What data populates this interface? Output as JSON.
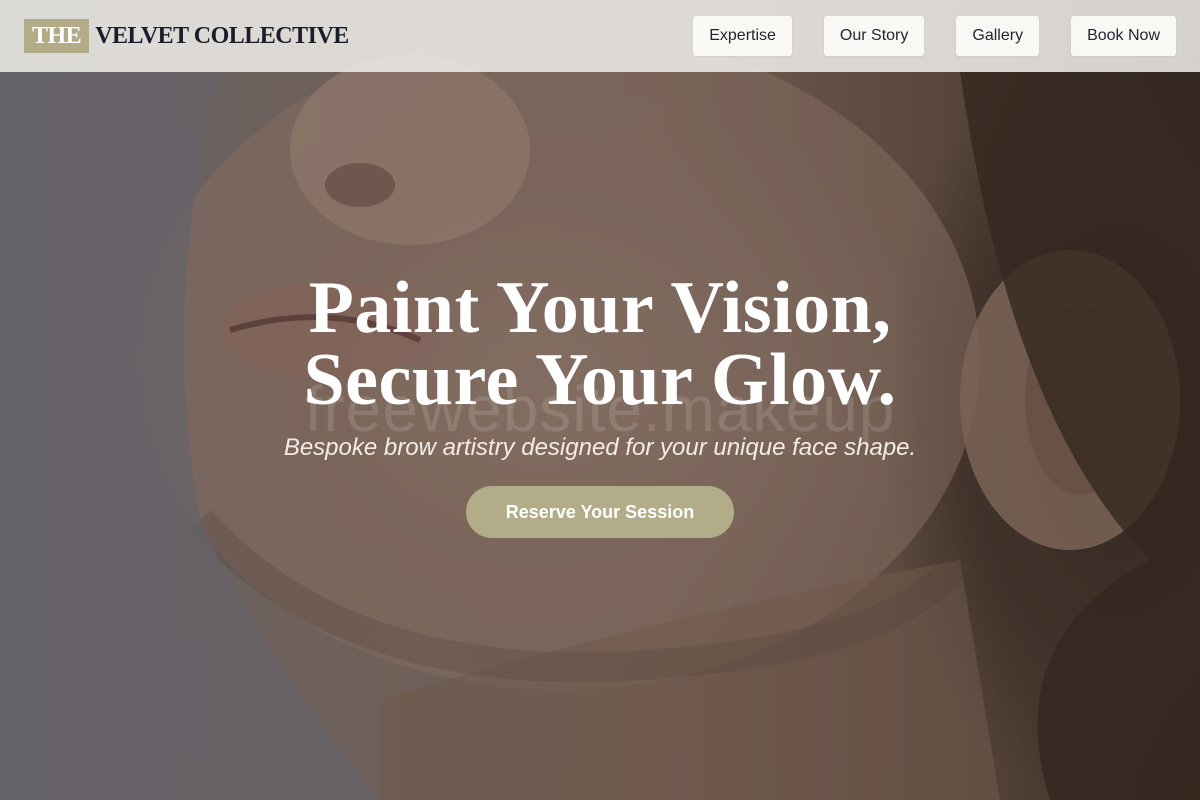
{
  "brand": {
    "badge": "THE",
    "name": "VELVET COLLECTIVE"
  },
  "nav": {
    "items": [
      "Expertise",
      "Our Story",
      "Gallery",
      "Book Now"
    ]
  },
  "hero": {
    "headline_line1": "Paint Your Vision,",
    "headline_line2": "Secure Your Glow.",
    "subheadline": "Bespoke brow artistry designed for your unique face shape.",
    "cta_label": "Reserve Your Session",
    "watermark": "freewebsite.makeup",
    "image_description_icon": "portrait-photo"
  },
  "colors": {
    "accent": "#b3ac88",
    "nav_bg": "#f0eeea",
    "logo_text": "#1b1d2b"
  }
}
